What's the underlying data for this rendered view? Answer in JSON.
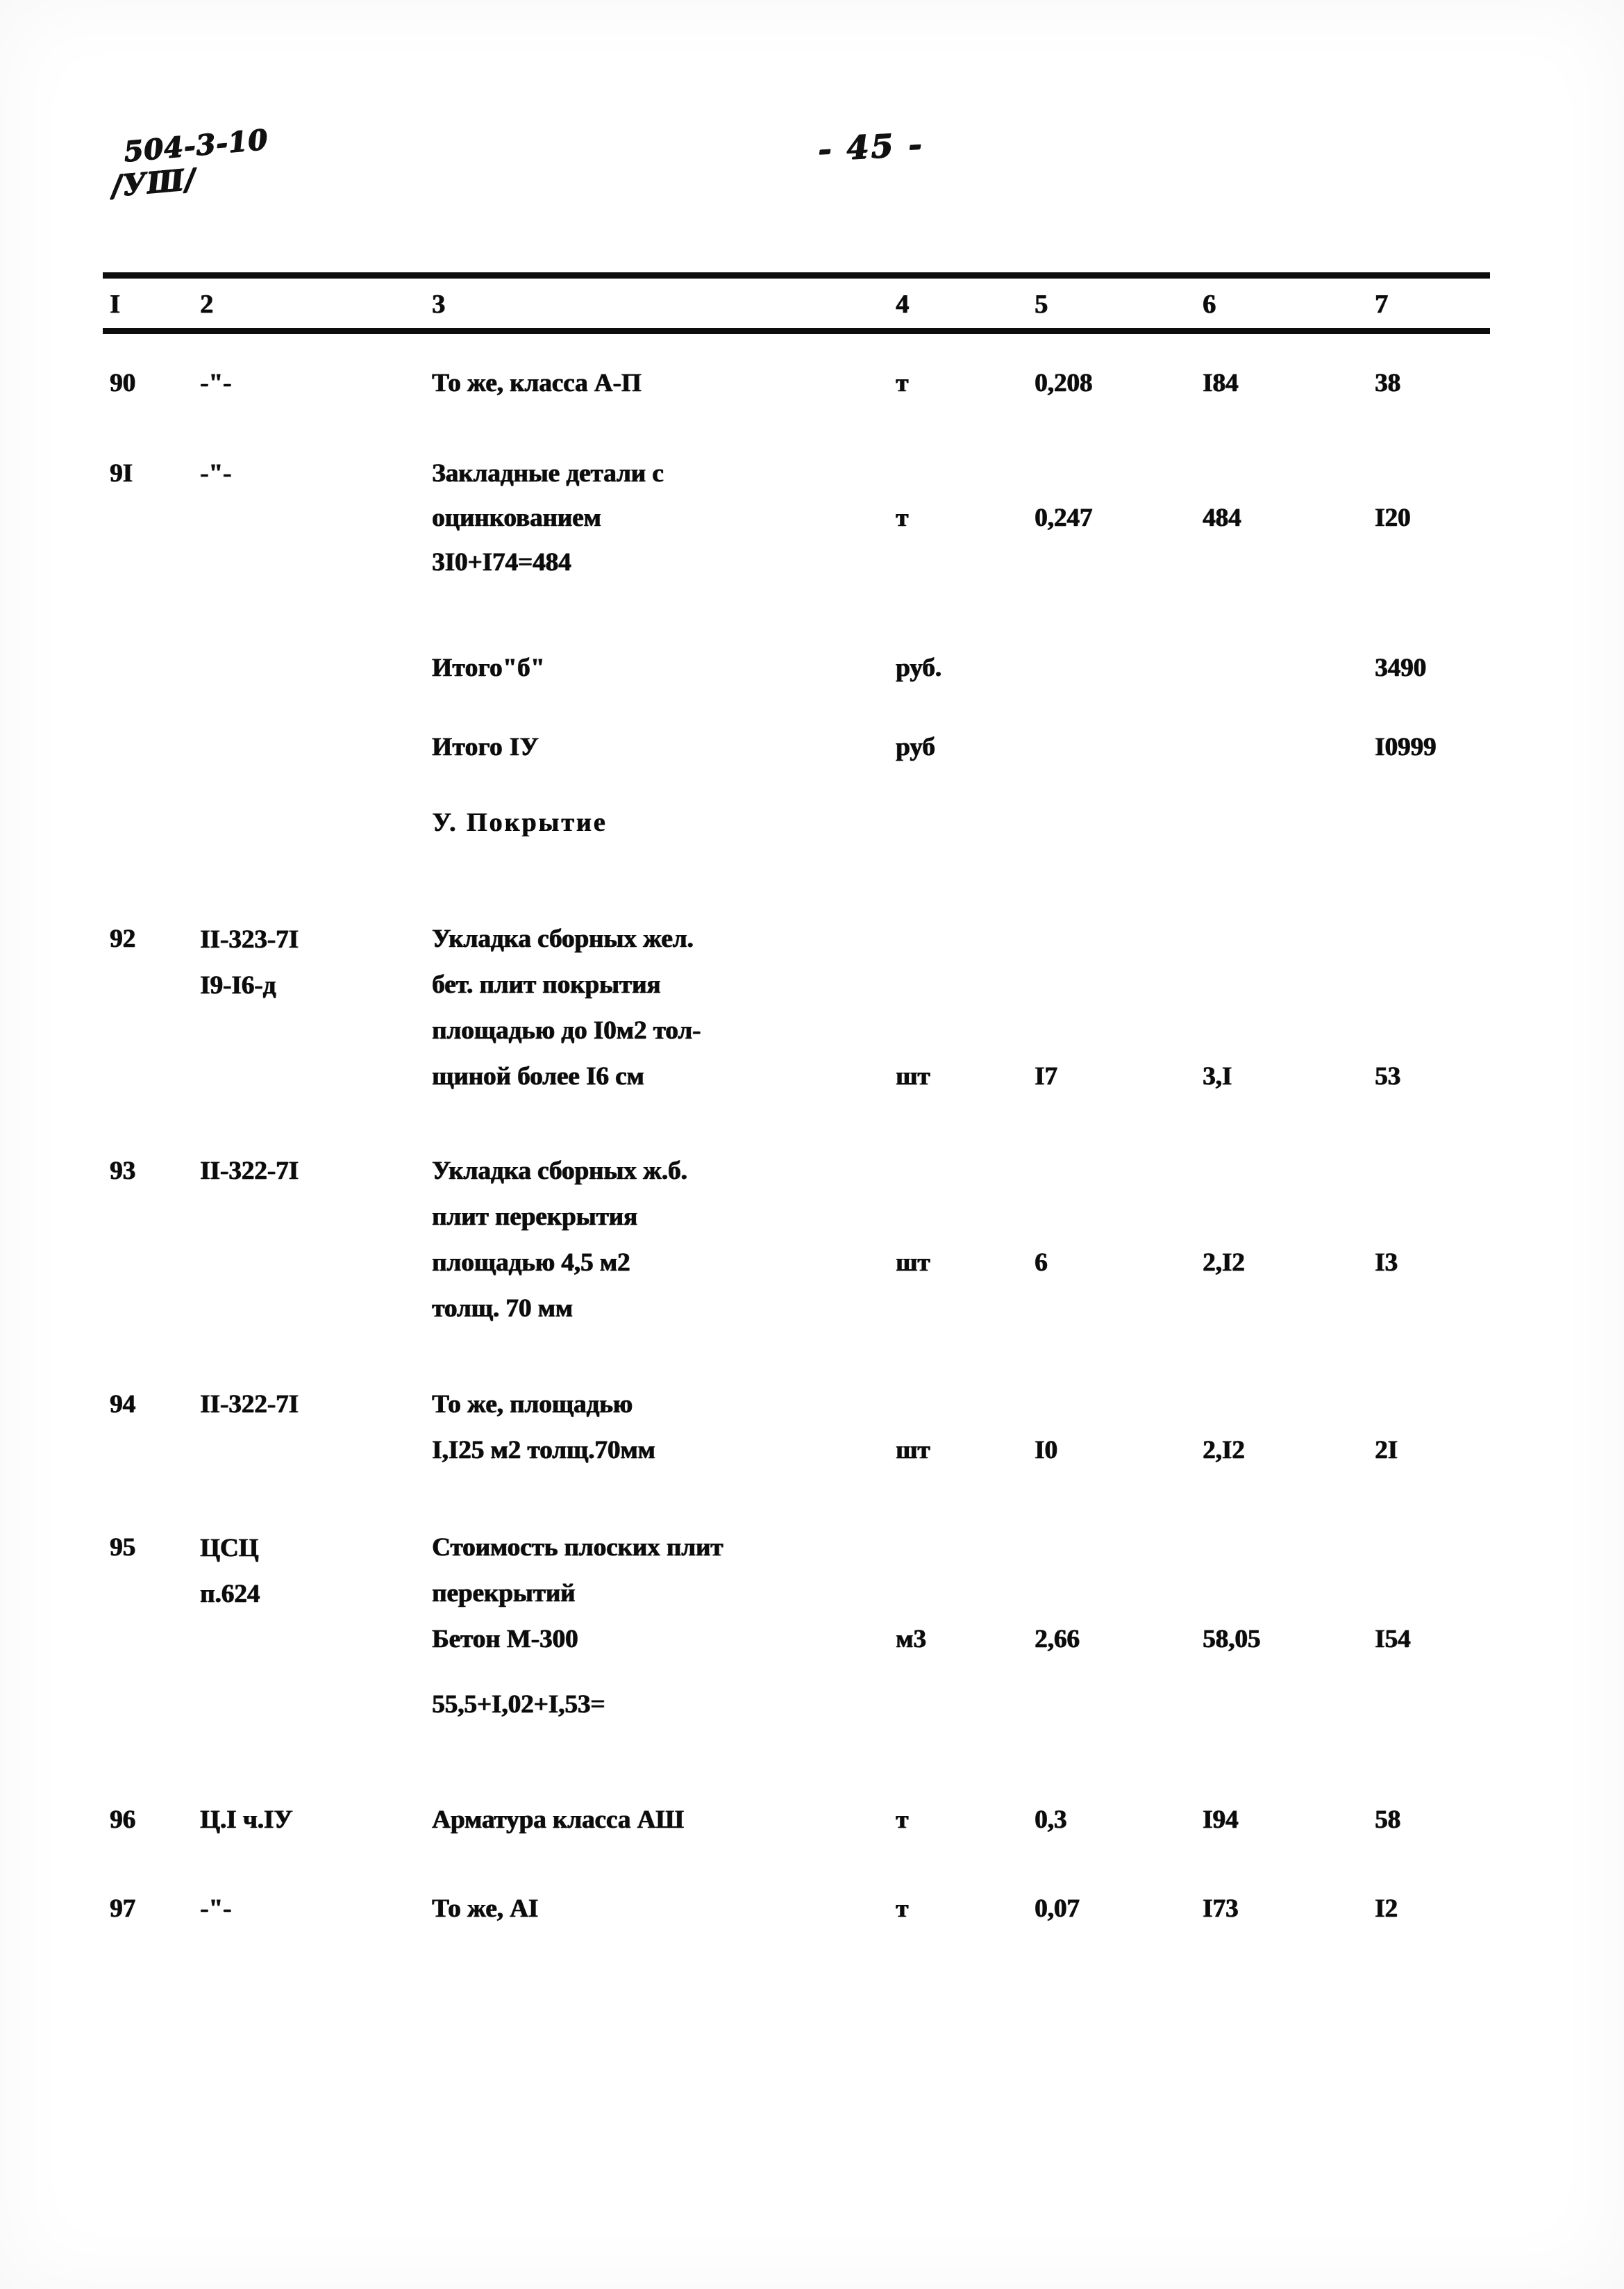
{
  "header": {
    "doc_code": "504-3-10",
    "doc_sheet": "/УШ/",
    "page_number": "- 45 -"
  },
  "table": {
    "column_headers": [
      "I",
      "2",
      "3",
      "4",
      "5",
      "6",
      "7"
    ],
    "rows": [
      {
        "no": "90",
        "code": "-\"-",
        "desc": [
          "То же, класса А-П"
        ],
        "unit": "т",
        "qty": "0,208",
        "price": "I84",
        "total": "38"
      },
      {
        "no": "9I",
        "code": "-\"-",
        "desc": [
          "Закладные детали с",
          "оцинкованием",
          "3I0+I74=484"
        ],
        "unit": "т",
        "qty": "0,247",
        "price": "484",
        "total": "I20"
      },
      {
        "no": "",
        "code": "",
        "desc": [
          "Итого\"б\""
        ],
        "unit": "руб.",
        "qty": "",
        "price": "",
        "total": "3490"
      },
      {
        "no": "",
        "code": "",
        "desc": [
          "Итого IУ"
        ],
        "unit": "руб",
        "qty": "",
        "price": "",
        "total": "I0999"
      },
      {
        "no": "92",
        "code": "II-323-7I\nI9-I6-д",
        "desc": [
          "Укладка сборных жел.",
          "бет. плит покрытия",
          "площадью до I0м2 тол-",
          "щиной более I6 см"
        ],
        "unit": "шт",
        "qty": "I7",
        "price": "3,I",
        "total": "53"
      },
      {
        "no": "93",
        "code": "II-322-7I",
        "desc": [
          "Укладка сборных ж.б.",
          "плит перекрытия",
          "площадью 4,5 м2",
          "толщ. 70 мм"
        ],
        "unit": "шт",
        "qty": "6",
        "price": "2,I2",
        "total": "I3"
      },
      {
        "no": "94",
        "code": "II-322-7I",
        "desc": [
          "То же, площадью",
          "I,I25 м2 толщ.70мм"
        ],
        "unit": "шт",
        "qty": "I0",
        "price": "2,I2",
        "total": "2I"
      },
      {
        "no": "95",
        "code": "ЦСЦ\nп.624",
        "desc": [
          "Стоимость плоских плит",
          "перекрытий",
          "Бетон М-300",
          "55,5+I,02+I,53="
        ],
        "unit": "м3",
        "qty": "2,66",
        "price": "58,05",
        "total": "I54"
      },
      {
        "no": "96",
        "code": "Ц.I ч.IУ",
        "desc": [
          "Арматура класса АШ"
        ],
        "unit": "т",
        "qty": "0,3",
        "price": "I94",
        "total": "58"
      },
      {
        "no": "97",
        "code": "-\"-",
        "desc": [
          "То же, АI"
        ],
        "unit": "т",
        "qty": "0,07",
        "price": "I73",
        "total": "I2"
      }
    ],
    "section_heading": "У. Покрытие"
  }
}
